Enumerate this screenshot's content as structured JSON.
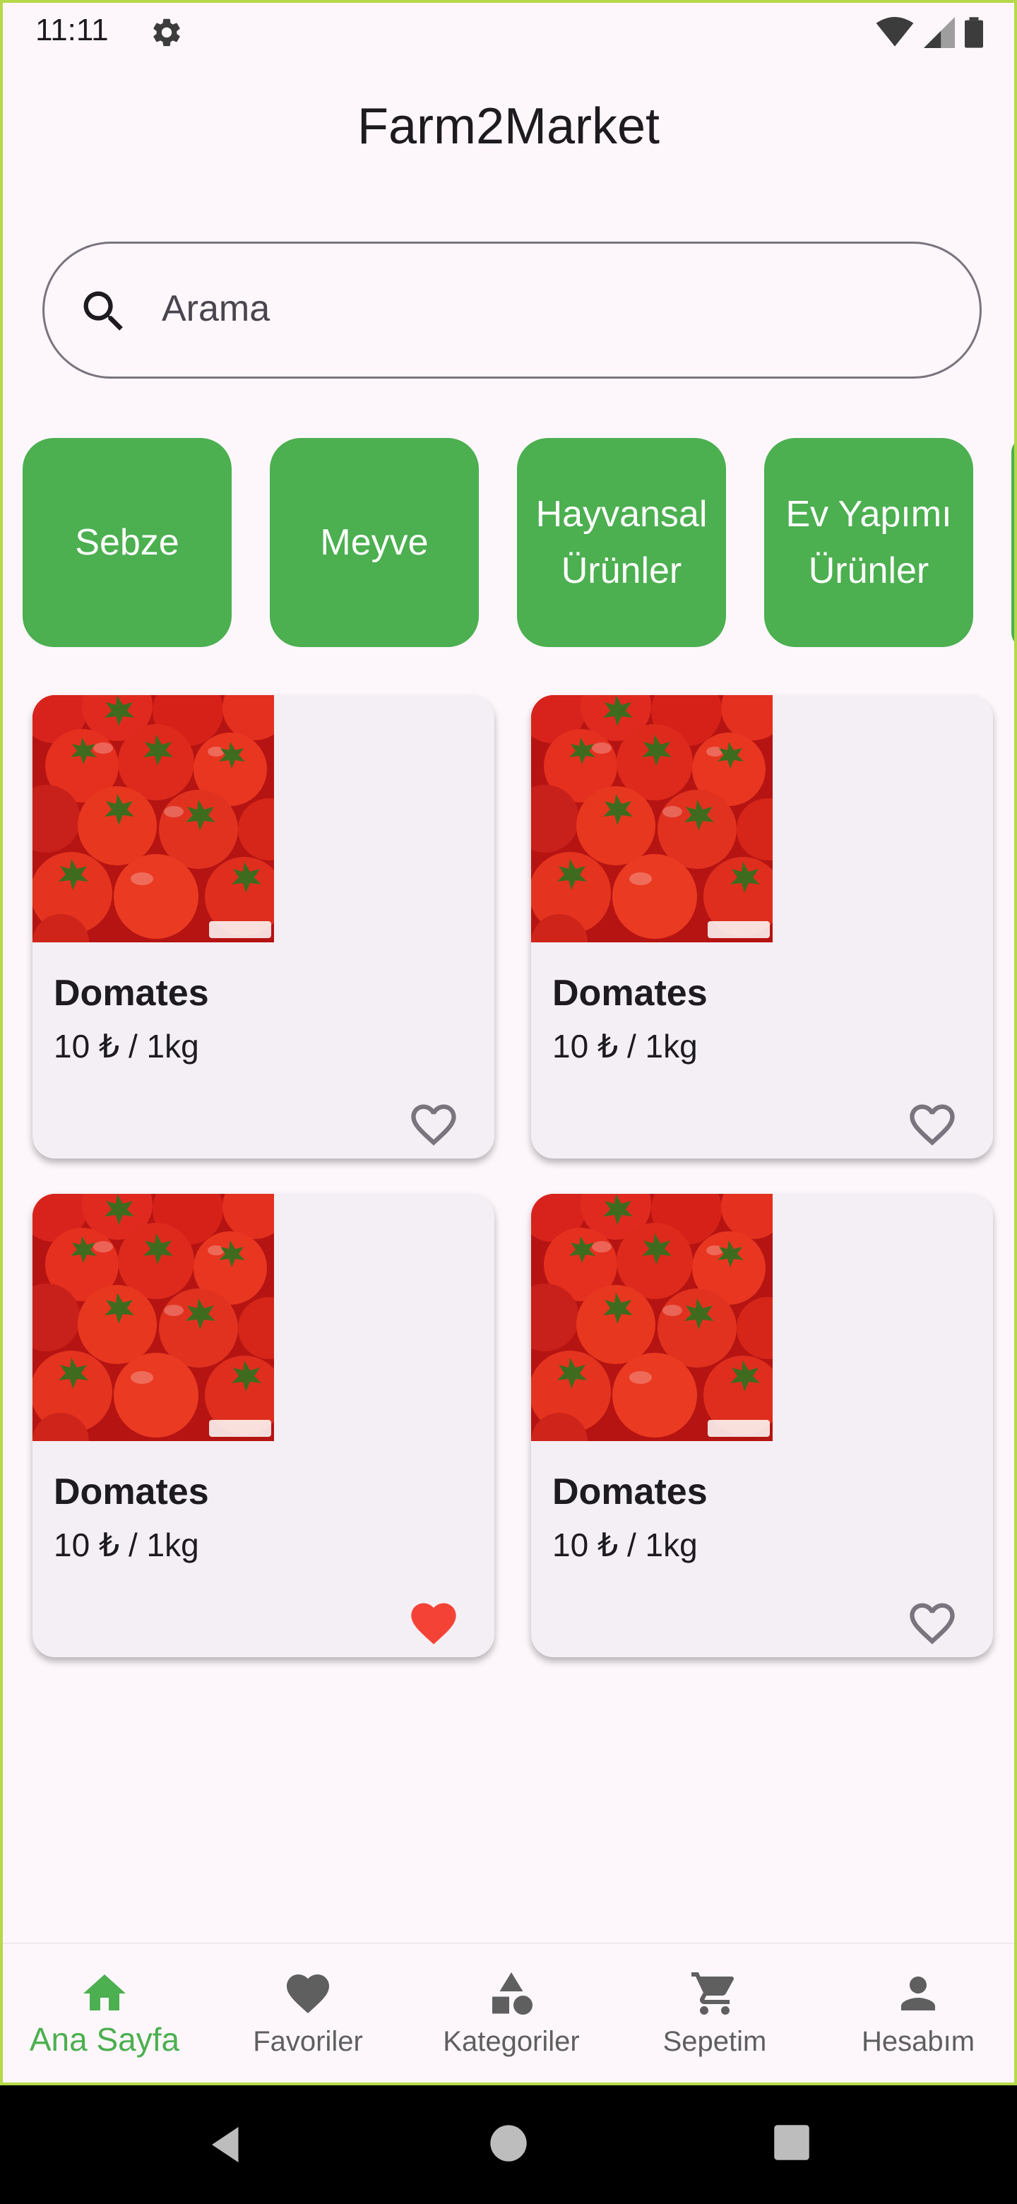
{
  "status": {
    "time": "11:11"
  },
  "app": {
    "title": "Farm2Market"
  },
  "search": {
    "placeholder": "Arama"
  },
  "categories": [
    {
      "label": "Sebze"
    },
    {
      "label": "Meyve"
    },
    {
      "label": "Hayvansal\nÜrünler"
    },
    {
      "label": "Ev Yapımı\nÜrünler"
    }
  ],
  "products": [
    {
      "name": "Domates",
      "price": "10 ₺ / 1kg",
      "favorite": false,
      "image": "tomatoes-photo"
    },
    {
      "name": "Domates",
      "price": "10 ₺ / 1kg",
      "favorite": false,
      "image": "tomatoes-photo"
    },
    {
      "name": "Domates",
      "price": "10 ₺ / 1kg",
      "favorite": true,
      "image": "tomatoes-photo"
    },
    {
      "name": "Domates",
      "price": "10 ₺ / 1kg",
      "favorite": false,
      "image": "tomatoes-photo"
    }
  ],
  "nav": {
    "items": [
      {
        "label": "Ana Sayfa",
        "icon": "home-icon",
        "active": true
      },
      {
        "label": "Favoriler",
        "icon": "heart-icon",
        "active": false
      },
      {
        "label": "Kategoriler",
        "icon": "category-icon",
        "active": false
      },
      {
        "label": "Sepetim",
        "icon": "cart-icon",
        "active": false
      },
      {
        "label": "Hesabım",
        "icon": "person-icon",
        "active": false
      }
    ]
  },
  "colors": {
    "accent": "#4caf50",
    "favorite": "#f44336",
    "background": "#fdf7fb",
    "card": "#f4eff4"
  }
}
